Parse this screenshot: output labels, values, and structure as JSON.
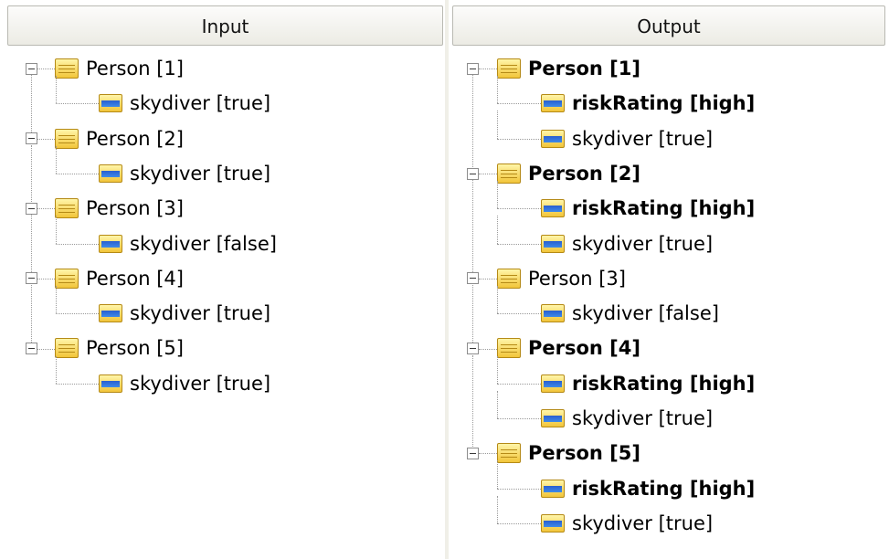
{
  "input": {
    "header": "Input",
    "nodes": [
      {
        "label": "Person [1]",
        "child": "skydiver [true]"
      },
      {
        "label": "Person [2]",
        "child": "skydiver [true]"
      },
      {
        "label": "Person [3]",
        "child": "skydiver [false]"
      },
      {
        "label": "Person [4]",
        "child": "skydiver [true]"
      },
      {
        "label": "Person [5]",
        "child": "skydiver [true]"
      }
    ]
  },
  "output": {
    "header": "Output",
    "nodes": [
      {
        "label": "Person [1]",
        "bold": true,
        "children": [
          {
            "label": "riskRating [high]",
            "bold": true
          },
          {
            "label": "skydiver [true]",
            "bold": false
          }
        ]
      },
      {
        "label": "Person [2]",
        "bold": true,
        "children": [
          {
            "label": "riskRating [high]",
            "bold": true
          },
          {
            "label": "skydiver [true]",
            "bold": false
          }
        ]
      },
      {
        "label": "Person [3]",
        "bold": false,
        "children": [
          {
            "label": "skydiver [false]",
            "bold": false
          }
        ]
      },
      {
        "label": "Person [4]",
        "bold": true,
        "children": [
          {
            "label": "riskRating [high]",
            "bold": true
          },
          {
            "label": "skydiver [true]",
            "bold": false
          }
        ]
      },
      {
        "label": "Person [5]",
        "bold": true,
        "children": [
          {
            "label": "riskRating [high]",
            "bold": true
          },
          {
            "label": "skydiver [true]",
            "bold": false
          }
        ]
      }
    ]
  },
  "icons": {
    "object": "object-icon",
    "field": "field-icon",
    "toggle": "collapse-icon"
  }
}
